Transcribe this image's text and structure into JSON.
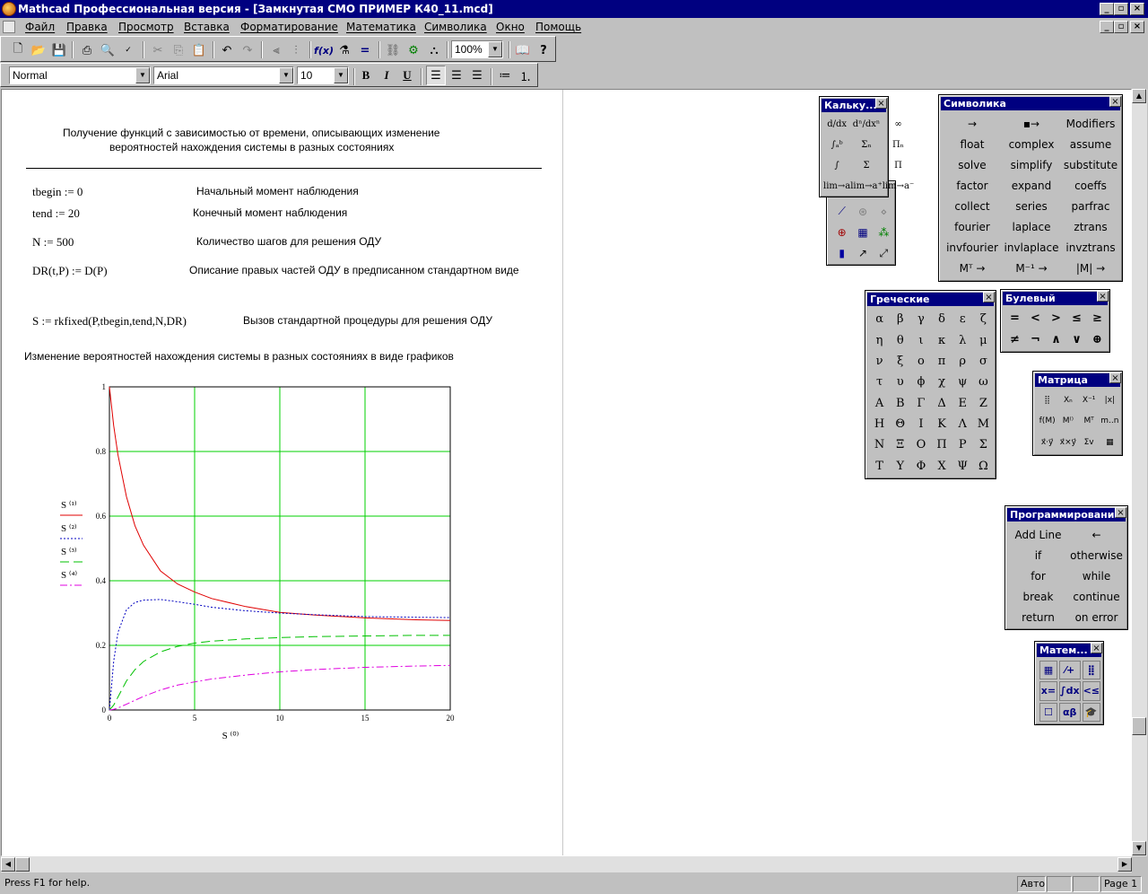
{
  "window": {
    "title": "Mathcad Профессиональная версия - [Замкнутая СМО  ПРИМЕР К40_11.mcd]",
    "minimize": "_",
    "restore": "▫",
    "close": "×"
  },
  "menu": [
    "Файл",
    "Правка",
    "Просмотр",
    "Вставка",
    "Форматирование",
    "Математика",
    "Символика",
    "Окно",
    "Помощь"
  ],
  "toolbar": {
    "zoom": "100%"
  },
  "formatbar": {
    "style": "Normal",
    "font": "Arial",
    "size": "10",
    "bold": "B",
    "italic": "I",
    "underline": "U"
  },
  "doc": {
    "heading_line1": "Получение  функций с зависимостью от времени, описывающих изменение",
    "heading_line2": "вероятностей  нахождения  системы  в разных состояниях",
    "rows": [
      {
        "expr": "tbegin := 0",
        "comment": "Начальный момент наблюдения"
      },
      {
        "expr": "tend := 20",
        "comment": "Конечный момент наблюдения"
      },
      {
        "expr": "N := 500",
        "comment": "Количество шагов для решения ОДУ"
      },
      {
        "expr": "DR(t,P) := D(P)",
        "comment": "Описание правых частей ОДУ в предписанном стандартном виде"
      },
      {
        "expr": "S := rkfixed(P,tbegin,tend,N,DR)",
        "comment": "Вызов стандартной процедуры для решения ОДУ"
      }
    ],
    "graph_caption": "Изменение  вероятностей  нахождения  системы  в разных состояниях в виде графиков"
  },
  "chart_data": {
    "type": "line",
    "xlabel": "S ⁽⁰⁾",
    "xlim": [
      0,
      20
    ],
    "ylim": [
      0,
      1
    ],
    "xticks": [
      0,
      5,
      10,
      15,
      20
    ],
    "yticks": [
      0,
      0.2,
      0.4,
      0.6,
      0.8,
      1
    ],
    "xtick_labels": [
      "0",
      "5",
      "10",
      "15",
      "20"
    ],
    "ytick_labels": [
      "0",
      "0.2",
      "0.4",
      "0.6",
      "0.8",
      "1"
    ],
    "grid": true,
    "x": [
      0,
      0.25,
      0.5,
      1,
      1.5,
      2,
      3,
      4,
      5,
      6,
      8,
      10,
      12,
      15,
      18,
      20
    ],
    "series": [
      {
        "name": "S ⁽¹⁾",
        "color": "#e00000",
        "style": "solid",
        "values": [
          1,
          0.88,
          0.79,
          0.66,
          0.57,
          0.51,
          0.43,
          0.39,
          0.365,
          0.345,
          0.32,
          0.302,
          0.294,
          0.285,
          0.279,
          0.277
        ]
      },
      {
        "name": "S ⁽²⁾",
        "color": "#0000c0",
        "style": "dotted",
        "values": [
          0,
          0.15,
          0.24,
          0.31,
          0.333,
          0.34,
          0.342,
          0.335,
          0.327,
          0.318,
          0.307,
          0.3,
          0.295,
          0.289,
          0.287,
          0.286
        ]
      },
      {
        "name": "S ⁽³⁾",
        "color": "#00c000",
        "style": "dashed",
        "values": [
          0,
          0.015,
          0.04,
          0.09,
          0.125,
          0.15,
          0.18,
          0.197,
          0.207,
          0.213,
          0.22,
          0.224,
          0.227,
          0.229,
          0.231,
          0.231
        ]
      },
      {
        "name": "S ⁽⁴⁾",
        "color": "#e000e0",
        "style": "dashdot",
        "values": [
          0,
          0.002,
          0.006,
          0.018,
          0.03,
          0.042,
          0.062,
          0.077,
          0.087,
          0.096,
          0.108,
          0.118,
          0.125,
          0.132,
          0.136,
          0.138
        ]
      }
    ]
  },
  "palettes": {
    "calculator": {
      "title": "Кальку...",
      "items": [
        "d/dx",
        "dⁿ/dxⁿ",
        "∞",
        "∫ₐᵇ",
        "Σₙ",
        "Πₙ",
        "∫",
        "Σ",
        "Π",
        "lim→a",
        "lim→a⁺",
        "lim→a⁻"
      ]
    },
    "graph": {
      "icons": [
        "xy-plot-icon",
        "polar-plot-icon",
        "surface-plot-icon",
        "pie-icon",
        "contour-icon",
        "3d-scatter-icon",
        "bar3d-icon",
        "vector-field-icon",
        "zoom-icon"
      ]
    },
    "symbolic": {
      "title": "Символика",
      "items": [
        "→",
        "▪→",
        "Modifiers",
        "float",
        "complex",
        "assume",
        "solve",
        "simplify",
        "substitute",
        "factor",
        "expand",
        "coeffs",
        "collect",
        "series",
        "parfrac",
        "fourier",
        "laplace",
        "ztrans",
        "invfourier",
        "invlaplace",
        "invztrans",
        "Mᵀ →",
        "M⁻¹ →",
        "|M| →"
      ]
    },
    "greek": {
      "title": "Греческие",
      "items": [
        "α",
        "β",
        "γ",
        "δ",
        "ε",
        "ζ",
        "η",
        "θ",
        "ι",
        "κ",
        "λ",
        "μ",
        "ν",
        "ξ",
        "ο",
        "π",
        "ρ",
        "σ",
        "τ",
        "υ",
        "ϕ",
        "χ",
        "ψ",
        "ω",
        "Α",
        "Β",
        "Γ",
        "Δ",
        "Ε",
        "Ζ",
        "Η",
        "Θ",
        "Ι",
        "Κ",
        "Λ",
        "Μ",
        "Ν",
        "Ξ",
        "Ο",
        "Π",
        "Ρ",
        "Σ",
        "Τ",
        "Υ",
        "Φ",
        "Χ",
        "Ψ",
        "Ω"
      ]
    },
    "boolean": {
      "title": "Булевый",
      "items": [
        "=",
        "<",
        ">",
        "≤",
        "≥",
        "≠",
        "¬",
        "∧",
        "∨",
        "⊕"
      ]
    },
    "matrix": {
      "title": "Матрица",
      "items": [
        "⣿",
        "Xₙ",
        "X⁻¹",
        "|x|",
        "f(M)",
        "M⁽⁾",
        "Mᵀ",
        "m..n",
        "x⃗·y⃗",
        "x⃗×y⃗",
        "Σv",
        "▦"
      ]
    },
    "programming": {
      "title": "Программирование",
      "items": [
        "Add Line",
        "←",
        "if",
        "otherwise",
        "for",
        "while",
        "break",
        "continue",
        "return",
        "on error"
      ]
    },
    "math": {
      "title": "Матем...",
      "items": [
        "▦",
        "⁄+",
        "⣿",
        "x=",
        "∫dx",
        "<≤",
        "☐",
        "αβ",
        "🎓"
      ]
    }
  },
  "status": {
    "help": "Press F1 for help.",
    "mode": "Авто",
    "page": "Page 1"
  }
}
